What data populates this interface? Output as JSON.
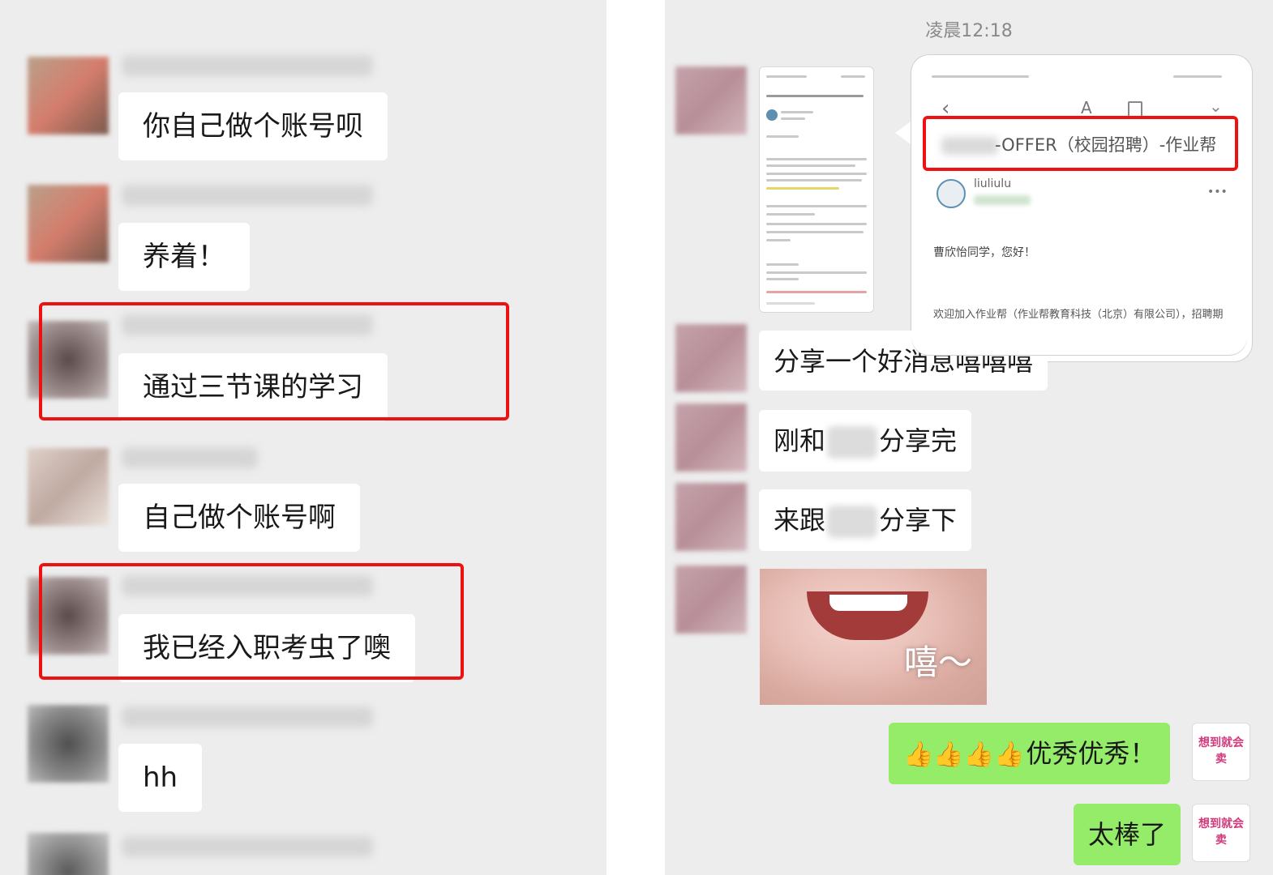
{
  "left_chat": {
    "messages": [
      {
        "text": "你自己做个账号呗"
      },
      {
        "text": "养着！"
      },
      {
        "text": "通过三节课的学习"
      },
      {
        "text": "自己做个账号啊"
      },
      {
        "text": "我已经入职考虫了噢"
      },
      {
        "text": "hh"
      }
    ]
  },
  "right_chat": {
    "timestamp": "凌晨12:18",
    "email_preview": {
      "subject_suffix": "-OFFER（校园招聘）-作业帮",
      "sender": "liuliulu",
      "greeting": "曹欣怡同学，您好！",
      "body_line": "欢迎加入作业帮（作业帮教育科技（北京）有限公司），招聘期您的书请注意附件。",
      "more": "•••"
    },
    "messages": [
      {
        "text": "分享一个好消息嘻嘻嘻"
      },
      {
        "pre": "刚和",
        "post": "分享完"
      },
      {
        "pre": "来跟",
        "post": "分享下"
      }
    ],
    "sticker_caption": "嘻～",
    "self_messages": [
      {
        "text": "优秀优秀！",
        "emoji": "👍👍👍👍"
      },
      {
        "text": "太棒了"
      }
    ],
    "self_avatar_text": "想到就会卖"
  },
  "colors": {
    "background": "#ededed",
    "bubble": "#ffffff",
    "self_bubble": "#95ec69",
    "highlight": "#ee1111"
  }
}
